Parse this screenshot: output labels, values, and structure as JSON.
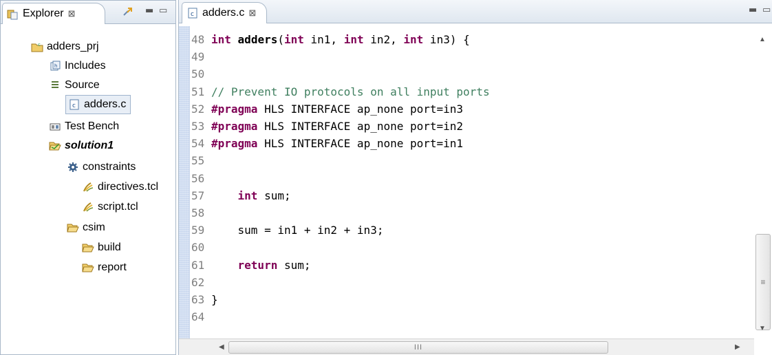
{
  "explorer": {
    "tab_label": "Explorer",
    "close_glyph": "⊠",
    "minimize_glyph": "▭",
    "tree": [
      {
        "label": "adders_prj",
        "icon": "project-folder-icon"
      },
      {
        "label": "Includes",
        "icon": "includes-icon"
      },
      {
        "label": "Source",
        "icon": "source-icon"
      },
      {
        "label": "adders.c",
        "icon": "c-file-icon"
      },
      {
        "label": "Test Bench",
        "icon": "testbench-icon"
      },
      {
        "label": "solution1",
        "icon": "open-folder-icon"
      },
      {
        "label": "constraints",
        "icon": "constraints-gear-icon"
      },
      {
        "label": "directives.tcl",
        "icon": "tcl-script-icon"
      },
      {
        "label": "script.tcl",
        "icon": "tcl-script-icon"
      },
      {
        "label": "csim",
        "icon": "open-folder-icon"
      },
      {
        "label": "build",
        "icon": "open-folder-icon"
      },
      {
        "label": "report",
        "icon": "open-folder-icon"
      }
    ]
  },
  "editor": {
    "tab_label": "adders.c",
    "close_glyph": "⊠",
    "hscroll_grip": "III",
    "vscroll_grip": "≡",
    "lines": [
      {
        "n": "48",
        "segments": [
          [
            "kw",
            "int"
          ],
          [
            "t",
            " "
          ],
          [
            "fn",
            "adders"
          ],
          [
            "t",
            "("
          ],
          [
            "kw",
            "int"
          ],
          [
            "t",
            " in1, "
          ],
          [
            "kw",
            "int"
          ],
          [
            "t",
            " in2, "
          ],
          [
            "kw",
            "int"
          ],
          [
            "t",
            " in3) {"
          ]
        ]
      },
      {
        "n": "49",
        "segments": []
      },
      {
        "n": "50",
        "segments": []
      },
      {
        "n": "51",
        "segments": [
          [
            "cm",
            "// Prevent IO protocols on all input ports"
          ]
        ]
      },
      {
        "n": "52",
        "segments": [
          [
            "kw",
            "#pragma"
          ],
          [
            "t",
            " HLS INTERFACE ap_none port=in3"
          ]
        ]
      },
      {
        "n": "53",
        "segments": [
          [
            "kw",
            "#pragma"
          ],
          [
            "t",
            " HLS INTERFACE ap_none port=in2"
          ]
        ]
      },
      {
        "n": "54",
        "segments": [
          [
            "kw",
            "#pragma"
          ],
          [
            "t",
            " HLS INTERFACE ap_none port=in1"
          ]
        ]
      },
      {
        "n": "55",
        "segments": []
      },
      {
        "n": "56",
        "segments": []
      },
      {
        "n": "57",
        "segments": [
          [
            "t",
            "    "
          ],
          [
            "kw",
            "int"
          ],
          [
            "t",
            " sum;"
          ]
        ]
      },
      {
        "n": "58",
        "segments": []
      },
      {
        "n": "59",
        "segments": [
          [
            "t",
            "    sum = in1 + in2 + in3;"
          ]
        ]
      },
      {
        "n": "60",
        "segments": []
      },
      {
        "n": "61",
        "segments": [
          [
            "t",
            "    "
          ],
          [
            "kw",
            "return"
          ],
          [
            "t",
            " sum;"
          ]
        ]
      },
      {
        "n": "62",
        "segments": []
      },
      {
        "n": "63",
        "segments": [
          [
            "t",
            "}"
          ]
        ]
      },
      {
        "n": "64",
        "segments": []
      }
    ]
  }
}
